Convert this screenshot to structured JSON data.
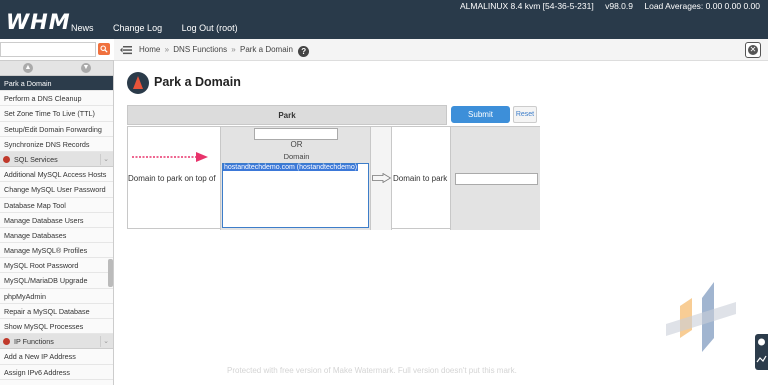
{
  "topbar": {
    "logo": "WHM",
    "nav": [
      "News",
      "Change Log",
      "Log Out (root)"
    ],
    "os": "ALMALINUX 8.4 kvm [54-36-5-231]",
    "version": "v98.0.9",
    "load": "Load Averages: 0.00 0.00 0.00"
  },
  "breadcrumb": {
    "home": "Home",
    "sep": "»",
    "section": "DNS Functions",
    "current": "Park a Domain"
  },
  "sidebar": {
    "items": [
      {
        "label": "Park a Domain",
        "type": "item",
        "active": true
      },
      {
        "label": "Perform a DNS Cleanup",
        "type": "item"
      },
      {
        "label": "Set Zone Time To Live (TTL)",
        "type": "item"
      },
      {
        "label": "Setup/Edit Domain Forwarding",
        "type": "item"
      },
      {
        "label": "Synchronize DNS Records",
        "type": "item"
      },
      {
        "label": "SQL Services",
        "type": "section"
      },
      {
        "label": "Additional MySQL Access Hosts",
        "type": "item"
      },
      {
        "label": "Change MySQL User Password",
        "type": "item"
      },
      {
        "label": "Database Map Tool",
        "type": "item"
      },
      {
        "label": "Manage Database Users",
        "type": "item"
      },
      {
        "label": "Manage Databases",
        "type": "item"
      },
      {
        "label": "Manage MySQL® Profiles",
        "type": "item"
      },
      {
        "label": "MySQL Root Password",
        "type": "item"
      },
      {
        "label": "MySQL/MariaDB Upgrade",
        "type": "item"
      },
      {
        "label": "phpMyAdmin",
        "type": "item"
      },
      {
        "label": "Repair a MySQL Database",
        "type": "item"
      },
      {
        "label": "Show MySQL Processes",
        "type": "item"
      },
      {
        "label": "IP Functions",
        "type": "section"
      },
      {
        "label": "Add a New IP Address",
        "type": "item"
      },
      {
        "label": "Assign IPv6 Address",
        "type": "item"
      }
    ]
  },
  "page": {
    "title": "Park a Domain",
    "park_header": "Park",
    "submit": "Submit",
    "reset": "Reset",
    "label_on_top_of": "Domain to park on top of",
    "or_text": "OR",
    "domain_text": "Domain",
    "selected_domain": "hostandtechdemo.com (hostandtechdemo)",
    "label_to_park": "Domain to park",
    "top_input_value": "",
    "park_input_value": ""
  },
  "watermark": "Protected with free version of Make Watermark. Full version doesn't put this mark.",
  "colors": {
    "topbar": "#293a4a",
    "submit": "#3d8fd9",
    "active_item": "#2c3c4b",
    "arrow": "#e8336b"
  }
}
